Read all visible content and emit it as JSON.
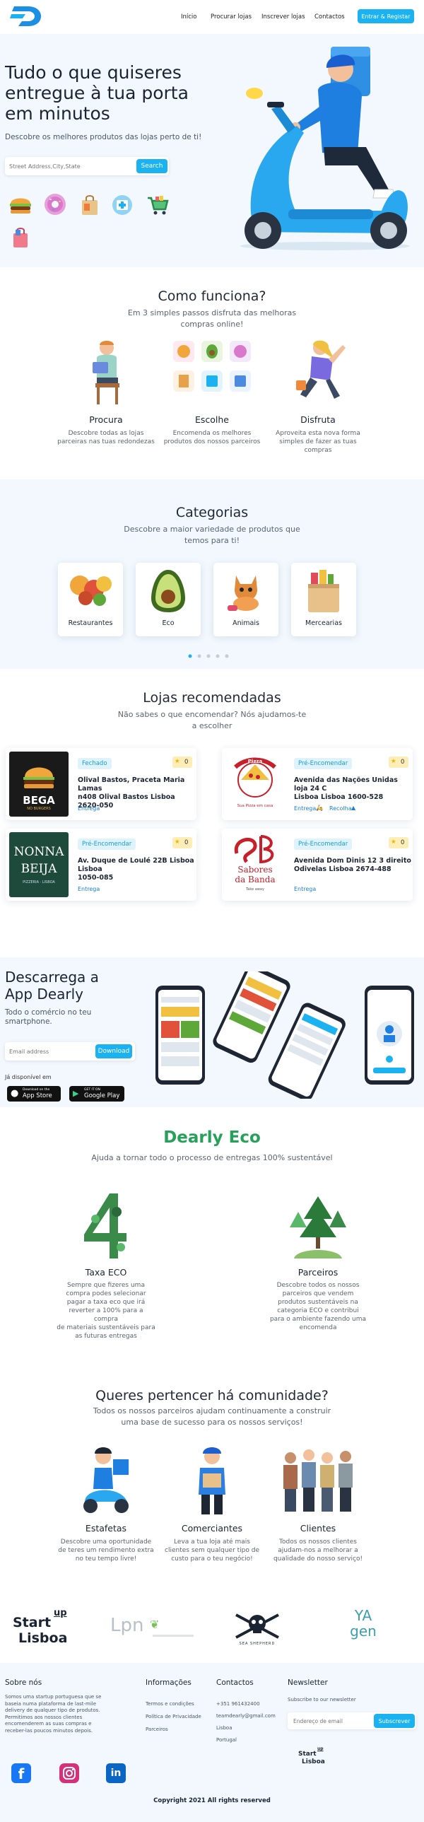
{
  "nav": {
    "links": [
      "Início",
      "Procurar lojas",
      "Inscrever lojas",
      "Contactos"
    ],
    "cta": "Entrar & Registar"
  },
  "hero": {
    "title_lines": [
      "Tudo o que quiseres",
      "entregue à tua porta",
      "em minutos"
    ],
    "subtitle": "Descobre os melhores produtos das lojas perto de ti!",
    "search_placeholder": "Street Address,City,State",
    "search_button": "Search"
  },
  "how": {
    "title": "Como funciona?",
    "subtitle_lines": [
      "Em 3 simples passos disfruta das melhoras",
      "compras online!"
    ],
    "steps": [
      {
        "title": "Procura",
        "lines": [
          "Descobre todas as lojas",
          "parceiras nas tuas redondezas"
        ]
      },
      {
        "title": "Escolhe",
        "lines": [
          "Encomenda os melhores",
          "produtos dos nossos parceiros"
        ]
      },
      {
        "title": "Disfruta",
        "lines": [
          "Aproveita esta nova forma",
          "simples de fazer as tuas",
          "compras"
        ]
      }
    ]
  },
  "categories": {
    "title": "Categorias",
    "subtitle_lines": [
      "Descobre a maior variedade de produtos que",
      "temos para ti!"
    ],
    "items": [
      "Restaurantes",
      "Eco",
      "Animais",
      "Mercearias"
    ]
  },
  "stores": {
    "title": "Lojas recomendadas",
    "subtitle_lines": [
      "Não sabes o que encomendar? Nós ajudamos-te",
      "a escolher"
    ],
    "cards": [
      {
        "logo_text": "BEGA",
        "logo_sub": "NO BURGERS",
        "status": "Fechado",
        "rating": "0",
        "address_lines": [
          "Olival Bastos, Praceta Maria Lamas",
          "n408 Olival Bastos Lisboa 2620-050"
        ],
        "tags": [
          "Entrega"
        ]
      },
      {
        "logo_text": "Pizza",
        "logo_sub": "Sua Pizza em casa",
        "status": "Pré-Encomendar",
        "rating": "0",
        "address_lines": [
          "Avenida das Nações Unidas loja 24 C",
          "Lisboa Lisboa 1600-528"
        ],
        "tags": [
          "Entrega",
          "Recolha"
        ]
      },
      {
        "logo_text": "NONNA",
        "logo_text2": "BEIJA",
        "logo_sub": "PIZZERIA · LISBOA",
        "status": "Pré-Encomendar",
        "rating": "0",
        "address_lines": [
          "Av. Duque de Loulé 22B Lisboa Lisboa",
          "1050-085"
        ],
        "tags": [
          "Entrega"
        ]
      },
      {
        "logo_text": "Sabores",
        "logo_text2": "da Banda",
        "logo_sub": "Take away",
        "status": "Pré-Encomendar",
        "rating": "0",
        "address_lines": [
          "Avenida Dom Dinis 12 3 direito",
          "Odivelas Lisboa 2674-488"
        ],
        "tags": [
          "Entrega"
        ]
      }
    ]
  },
  "app": {
    "title_lines": [
      "Descarrega a",
      "App Dearly"
    ],
    "subtitle_lines": [
      "Todo o comércio no teu",
      "smartphone."
    ],
    "email_placeholder": "Email address",
    "download_button": "Download",
    "available": "Já disponível em",
    "appstore_top": "Download on the",
    "appstore": "App Store",
    "googleplay_top": "GET IT ON",
    "googleplay": "Google Play"
  },
  "eco": {
    "title": "Dearly Eco",
    "subtitle": "Ajuda a tornar todo o processo de entregas 100% sustentável",
    "items": [
      {
        "title": "Taxa ECO",
        "lines": [
          "Sempre que fizeres uma",
          "compra podes selecionar",
          "pagar a taxa eco que irá",
          "reverter a 100% para a compra",
          "de materiais sustentáveis para",
          "as futuras entregas"
        ]
      },
      {
        "title": "Parceiros",
        "lines": [
          "Descobre todos os nossos",
          "parceiros que vendem",
          "produtos sustentáveis na",
          "categoria ECO e contribui",
          "para o ambiente fazendo uma",
          "encomenda"
        ]
      }
    ]
  },
  "community": {
    "title": "Queres pertencer há comunidade?",
    "subtitle_lines": [
      "Todos os nossos parceiros ajudam continuamente a construir",
      "uma base de sucesso para os nossos serviços!"
    ],
    "items": [
      {
        "title": "Estafetas",
        "lines": [
          "Descobre uma oportunidade",
          "de teres um rendimento extra",
          "no teu tempo livre!"
        ]
      },
      {
        "title": "Comerciantes",
        "lines": [
          "Leva a tua loja até mais",
          "clientes sem qualquer tipo de",
          "custo para o teu negócio!"
        ]
      },
      {
        "title": "Clientes",
        "lines": [
          "Todos os nossos clientes",
          "ajudam-nos a melhorar a",
          "qualidade do nosso serviço!"
        ]
      }
    ]
  },
  "partners": {
    "startup_lines": [
      "Start",
      "up",
      "Lisboa"
    ],
    "lpn": "Lpn",
    "seashepherd": "SEA SHEPHERD",
    "yagen_lines": [
      "YA",
      "gen"
    ]
  },
  "footer": {
    "about_title": "Sobre nós",
    "about_lines": [
      "Somos uma startup portuguesa que se",
      "baseia numa plataforma de last-mile",
      "delivery de qualquer tipo de produtos.",
      "Permitimos aos nossos clientes",
      "encomenderem as suas compras e",
      "receber-las poucos minutos depois."
    ],
    "info_title": "Informações",
    "info_links": [
      "Termos e condições",
      "Política de Privacidade",
      "Parceiros"
    ],
    "contacts_title": "Contactos",
    "contacts": [
      "+351 961432400",
      "teamdearly@gmail.com",
      "Lisboa",
      "Portugal"
    ],
    "newsletter_title": "Newsletter",
    "newsletter_text": "Subscribe to our newsletter",
    "newsletter_placeholder": "Endereço de email",
    "newsletter_button": "Subscrever",
    "startup_lines": [
      "Start",
      "up",
      "Lisboa"
    ],
    "copyright": "Copyright 2021 All rights reserved"
  },
  "colors": {
    "accent": "#1ab2f0",
    "eco_green": "#27a05a",
    "hero_bg": "#f2f8fd"
  }
}
